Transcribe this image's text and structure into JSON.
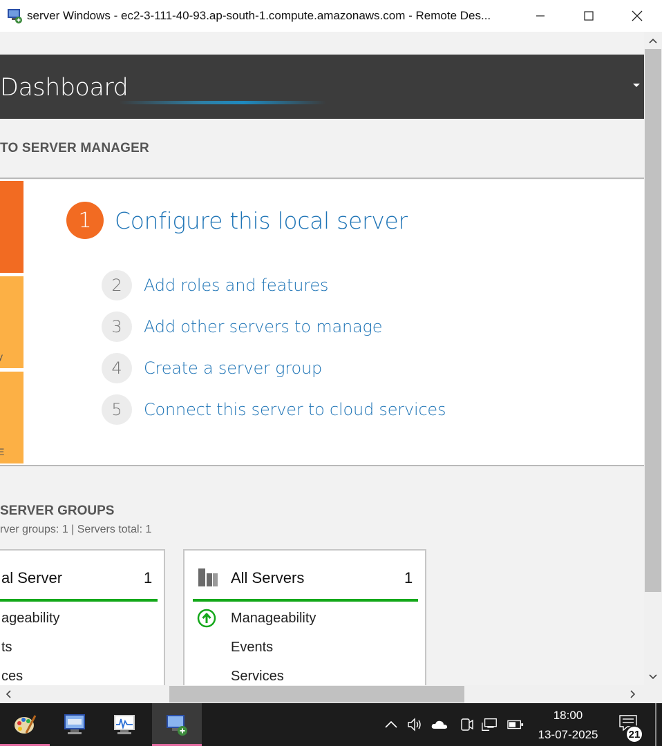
{
  "window": {
    "title": "server Windows - ec2-3-111-40-93.ap-south-1.compute.amazonaws.com - Remote Des..."
  },
  "server_manager": {
    "header_title": "Dashboard",
    "welcome_heading": "TO SERVER MANAGER",
    "steps": [
      {
        "number": "1",
        "label": "Configure this local server"
      },
      {
        "number": "2",
        "label": "Add roles and features"
      },
      {
        "number": "3",
        "label": "Add other servers to manage"
      },
      {
        "number": "4",
        "label": "Create a server group"
      },
      {
        "number": "5",
        "label": "Connect this server to cloud services"
      }
    ],
    "tile_glyphs": [
      "y",
      "E"
    ],
    "groups_heading": "SERVER GROUPS",
    "groups_counts": "rver groups: 1   |   Servers total: 1",
    "cards": [
      {
        "title": "al Server",
        "count": "1",
        "rows": [
          "ageability",
          "ts",
          "ces"
        ]
      },
      {
        "title": "All Servers",
        "count": "1",
        "rows": [
          "Manageability",
          "Events",
          "Services"
        ]
      }
    ]
  },
  "taskbar": {
    "time": "18:00",
    "date": "13-07-2025",
    "notification_count": "21"
  },
  "colors": {
    "header_bg": "#3c3c3c",
    "accent_orange": "#f26b22",
    "tile_yellow": "#fcb045",
    "link_blue": "#1e74b6",
    "status_green": "#14a81a"
  }
}
